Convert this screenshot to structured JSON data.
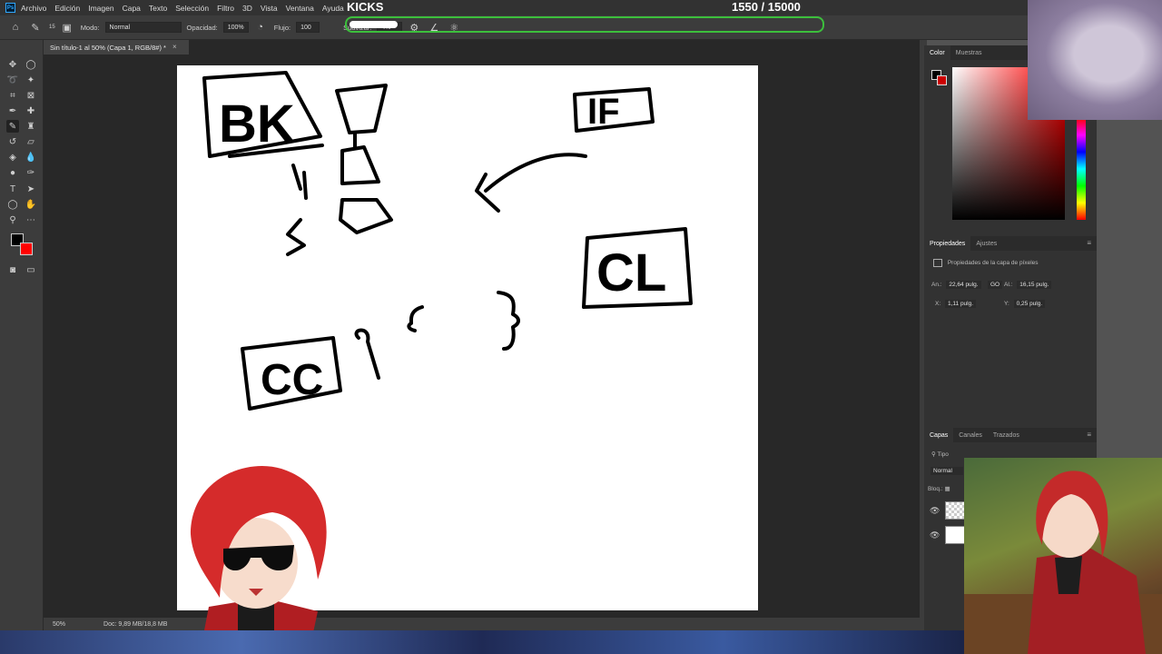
{
  "menu": {
    "items": [
      "Archivo",
      "Edición",
      "Imagen",
      "Capa",
      "Texto",
      "Selección",
      "Filtro",
      "3D",
      "Vista",
      "Ventana",
      "Ayuda"
    ]
  },
  "overlay": {
    "kicks_label": "KICKS",
    "kicks_count": "1550  / 15000",
    "progress_fraction": 0.103
  },
  "options": {
    "brush_size": "15",
    "mode_label": "Modo:",
    "mode_value": "Normal",
    "opacity_label": "Opacidad:",
    "opacity_value": "100%",
    "flow_label": "Flujo:",
    "flow_value": "100",
    "smooth_label": "Suavizar:",
    "smooth_value": "4%"
  },
  "document": {
    "tab_title": "Sin título-1 al 50% (Capa 1, RGB/8#) *",
    "zoom": "50%",
    "doc_info": "Doc: 9,89 MB/18,8 MB"
  },
  "panels": {
    "color_tabs": [
      "Color",
      "Muestras"
    ],
    "properties_tabs": [
      "Propiedades",
      "Ajustes"
    ],
    "properties_title": "Propiedades de la capa de píxeles",
    "width_label": "An.:",
    "width_value": "22,64 pulg.",
    "height_label": "Al.:",
    "height_value": "16,15 pulg.",
    "link_label": "GO",
    "x_label": "X:",
    "x_value": "1,11 pulg.",
    "y_label": "Y:",
    "y_value": "0,25 pulg.",
    "layers_tabs": [
      "Capas",
      "Canales",
      "Trazados"
    ],
    "filter_label": "Tipo",
    "blend_mode": "Normal",
    "lock_label": "Bloq.:"
  },
  "canvas_sketch": {
    "labels": [
      "BK",
      "IF",
      "CL",
      "CC"
    ]
  },
  "colors": {
    "progress_border": "#3cbf3c",
    "foreground": "#000000",
    "background": "#ff0000"
  }
}
